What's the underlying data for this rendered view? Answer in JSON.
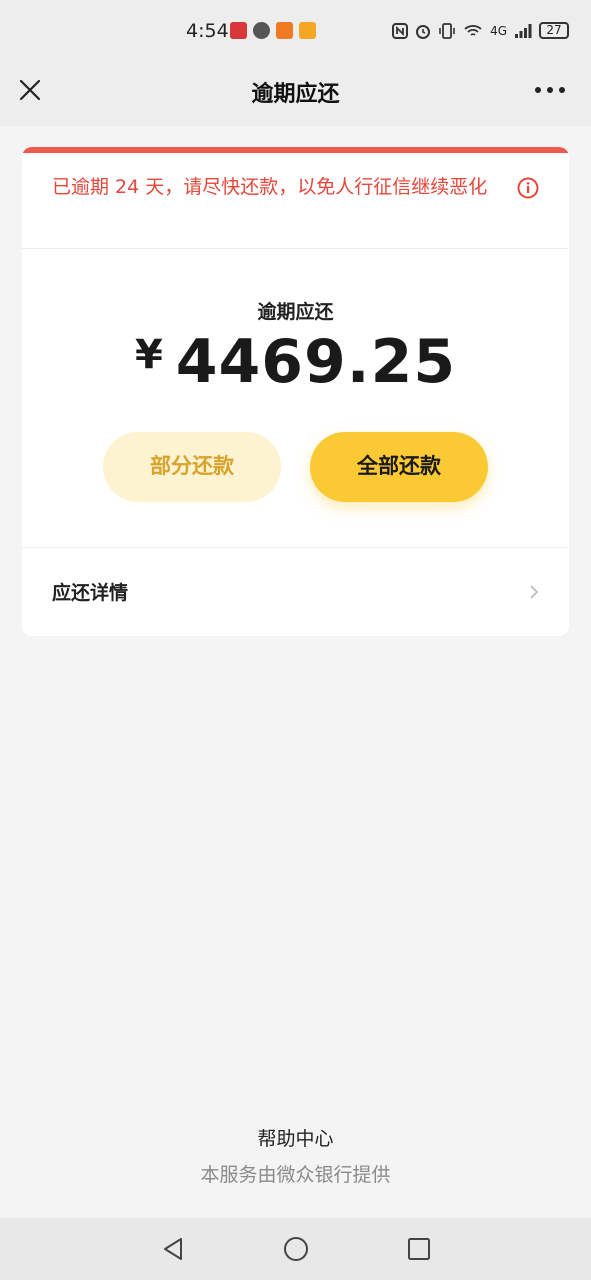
{
  "status": {
    "time": "4:54",
    "network": "4G",
    "battery": "27"
  },
  "nav": {
    "title": "逾期应还"
  },
  "warning": {
    "text": "已逾期 24 天，请尽快还款，以免人行征信继续恶化"
  },
  "amount": {
    "label": "逾期应还",
    "currency": "¥",
    "value": "4469.25"
  },
  "buttons": {
    "partial": "部分还款",
    "full": "全部还款"
  },
  "detail": {
    "label": "应还详情"
  },
  "footer": {
    "help": "帮助中心",
    "note": "本服务由微众银行提供"
  },
  "colors": {
    "warning_red": "#e5473b",
    "accent_yellow": "#fbc933",
    "partial_bg": "#fdf3d0"
  }
}
